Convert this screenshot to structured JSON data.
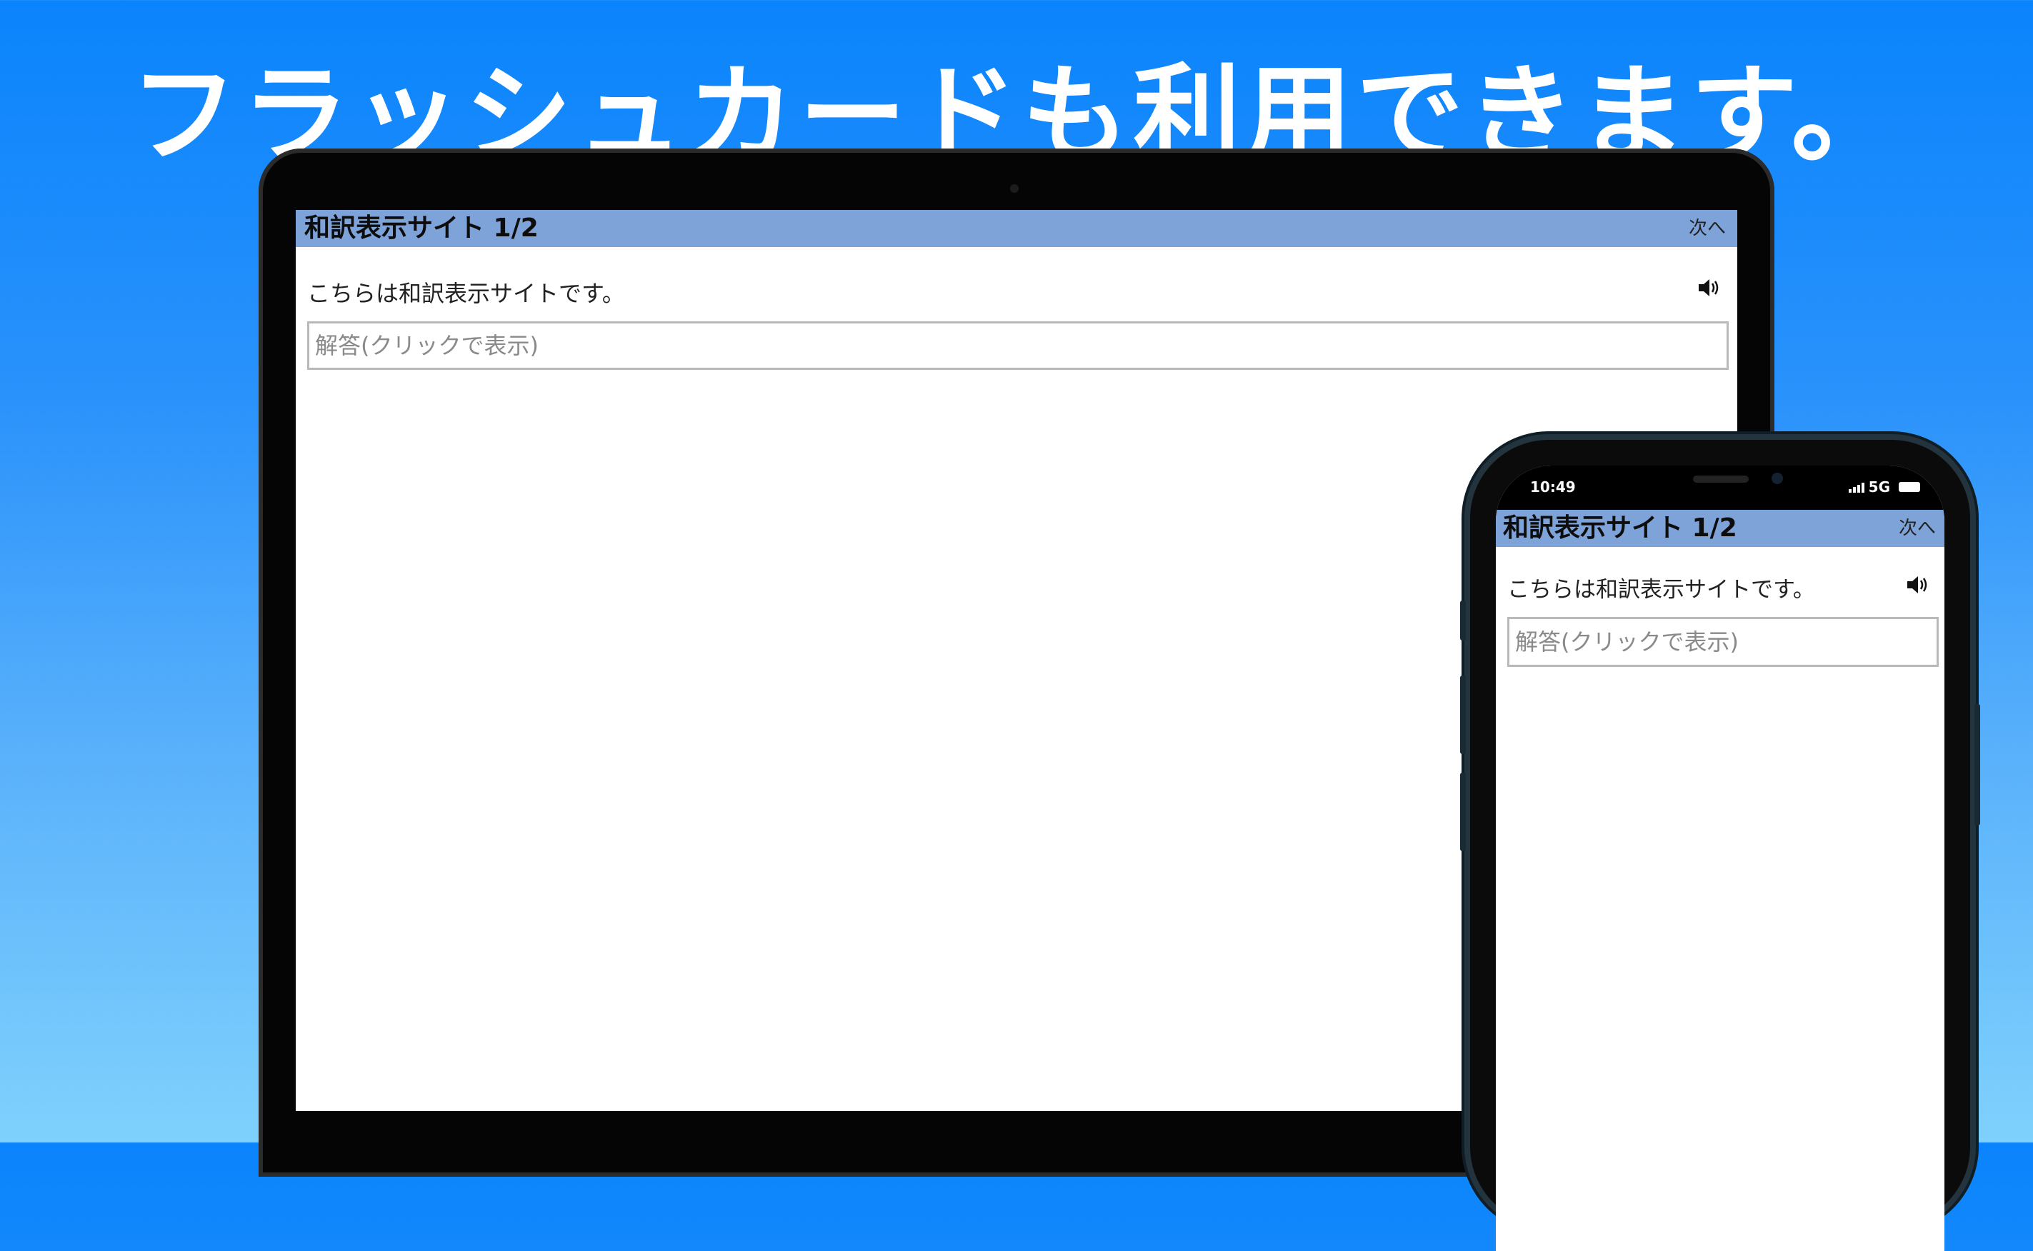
{
  "headline": "フラッシュカードも利用できます。",
  "laptop": {
    "header": {
      "title": "和訳表示サイト 1/2",
      "next_label": "次へ"
    },
    "question": "こちらは和訳表示サイトです。",
    "answer_placeholder": "解答(クリックで表示)"
  },
  "phone": {
    "status": {
      "time": "10:49",
      "network": "5G"
    },
    "header": {
      "title": "和訳表示サイト 1/2",
      "next_label": "次へ"
    },
    "question": "こちらは和訳表示サイトです。",
    "answer_placeholder": "解答(クリックで表示)"
  },
  "colors": {
    "header_bg": "#7ea3d8",
    "background_top": "#0a84fc",
    "background_bottom": "#7fd1fc"
  },
  "icons": [
    "speaker-icon",
    "signal-icon",
    "battery-icon"
  ]
}
